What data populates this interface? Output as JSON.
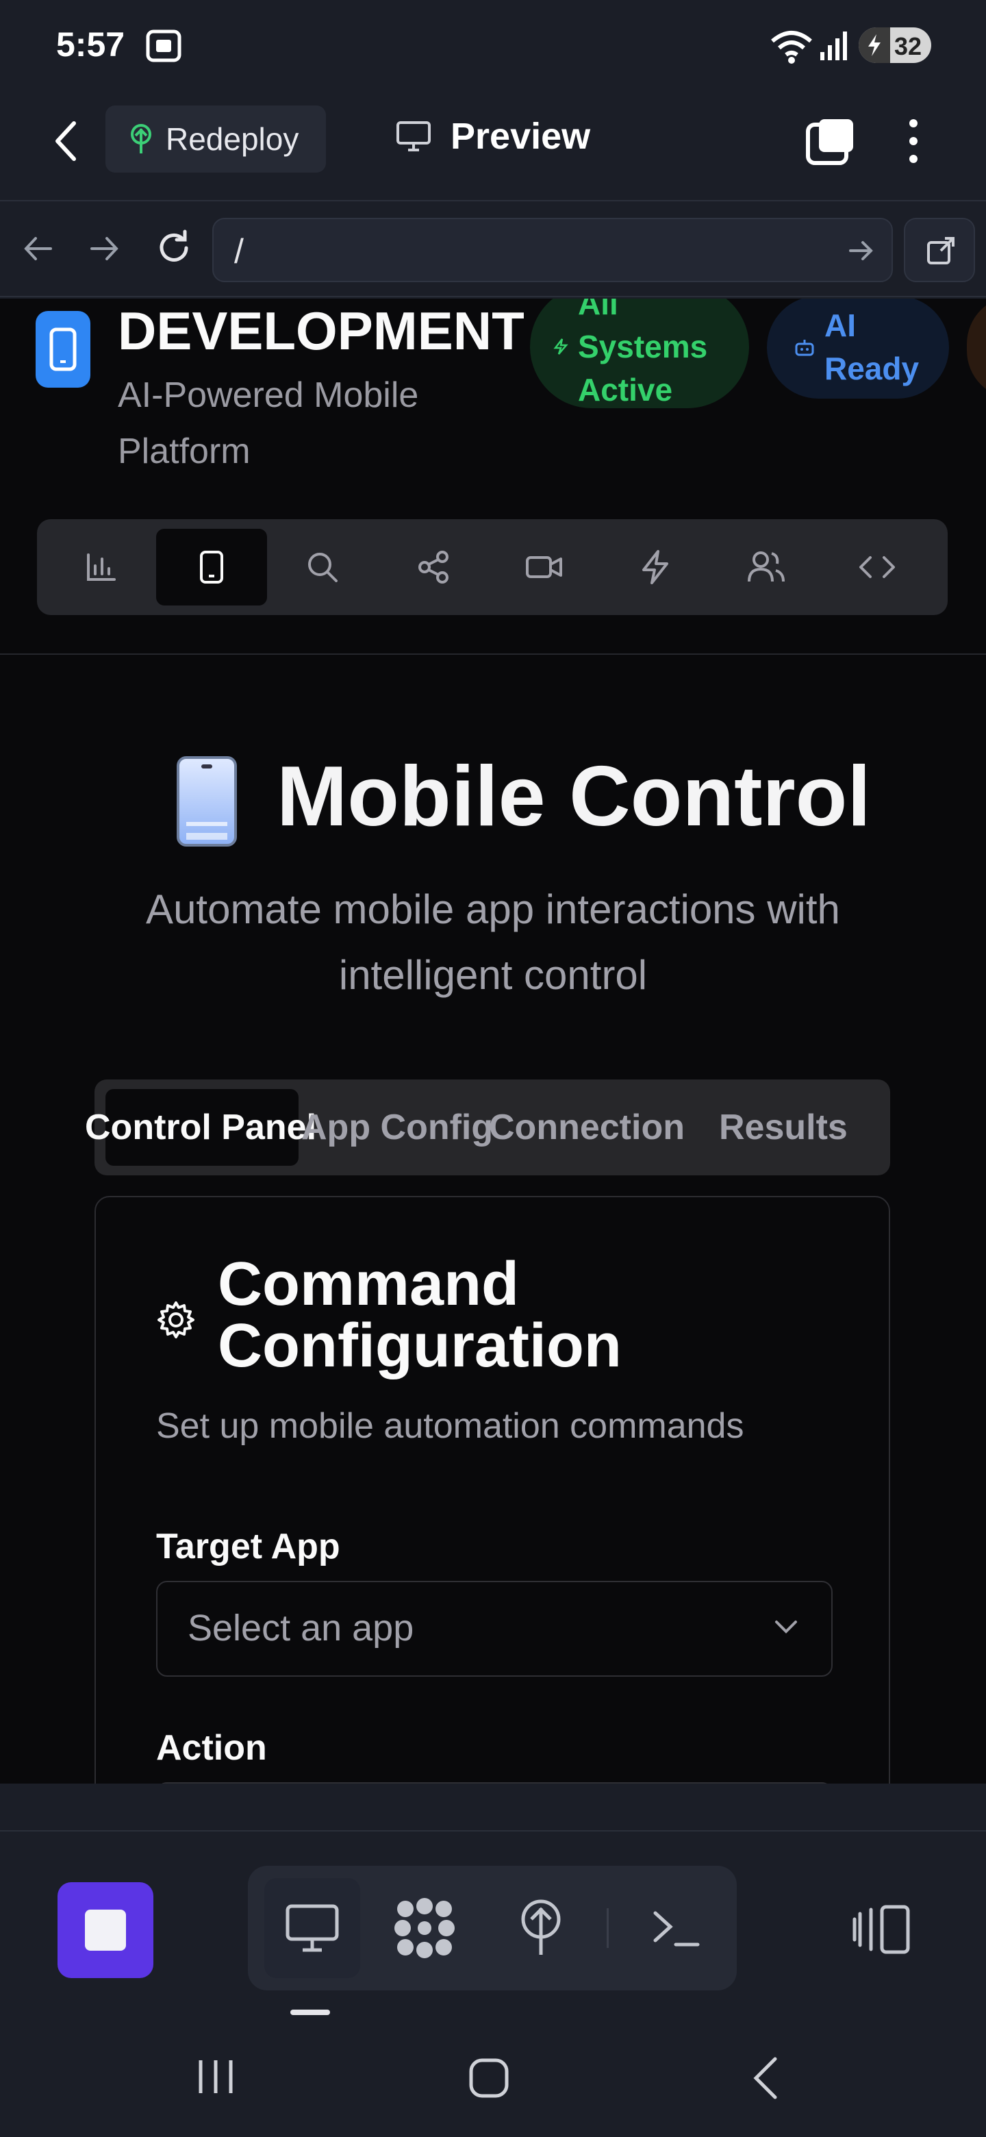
{
  "status_bar": {
    "time": "5:57",
    "battery_level": "32",
    "icons": [
      "screenshot-icon",
      "wifi-icon",
      "signal-icon",
      "battery-icon"
    ]
  },
  "app_header": {
    "back_icon": "chevron-left-icon",
    "redeploy_label": "Redeploy",
    "preview_label": "Preview",
    "icons": [
      "back-icon",
      "redeploy-icon",
      "monitor-icon",
      "tabs-icon",
      "more-icon"
    ]
  },
  "url_bar": {
    "value": "/",
    "icons": [
      "back-arrow-icon",
      "forward-arrow-icon",
      "reload-icon",
      "go-arrow-icon",
      "open-external-icon"
    ]
  },
  "site_header": {
    "title": "DEVELOPMENT",
    "subtitle": "AI-Powered Mobile Platform",
    "badge_systems": "All Systems Active",
    "badge_ai": "AI Ready",
    "colors": {
      "green": "#34d16b",
      "blue": "#4c8ff0",
      "accent": "#2f86f3"
    }
  },
  "toolbar": {
    "items": [
      {
        "name": "analytics",
        "icon": "bar-chart-icon"
      },
      {
        "name": "mobile",
        "icon": "smartphone-icon",
        "active": true
      },
      {
        "name": "search",
        "icon": "search-icon"
      },
      {
        "name": "share",
        "icon": "share-icon"
      },
      {
        "name": "video",
        "icon": "video-icon"
      },
      {
        "name": "automation",
        "icon": "zap-icon"
      },
      {
        "name": "users",
        "icon": "users-icon"
      },
      {
        "name": "code",
        "icon": "code-icon"
      }
    ]
  },
  "hero": {
    "icon": "mobile-phone-emoji",
    "title": "Mobile Control",
    "subtitle": "Automate mobile app interactions with intelligent control"
  },
  "tabs": [
    {
      "label": "Control Panel",
      "active": true
    },
    {
      "label": "App Config",
      "active": false
    },
    {
      "label": "Connection",
      "active": false
    },
    {
      "label": "Results",
      "active": false
    }
  ],
  "card": {
    "title": "Command Configuration",
    "subtitle": "Set up mobile automation commands",
    "target_app_label": "Target App",
    "target_app_placeholder": "Select an app",
    "action_label": "Action"
  },
  "bottom_bar": {
    "stop_icon": "stop-icon",
    "icons": [
      "desktop-icon",
      "flower-icon",
      "deploy-icon",
      "terminal-icon",
      "split-view-icon"
    ],
    "accent": "#5b35e4"
  },
  "system_nav": {
    "icons": [
      "recents-icon",
      "home-icon",
      "back-icon"
    ]
  }
}
